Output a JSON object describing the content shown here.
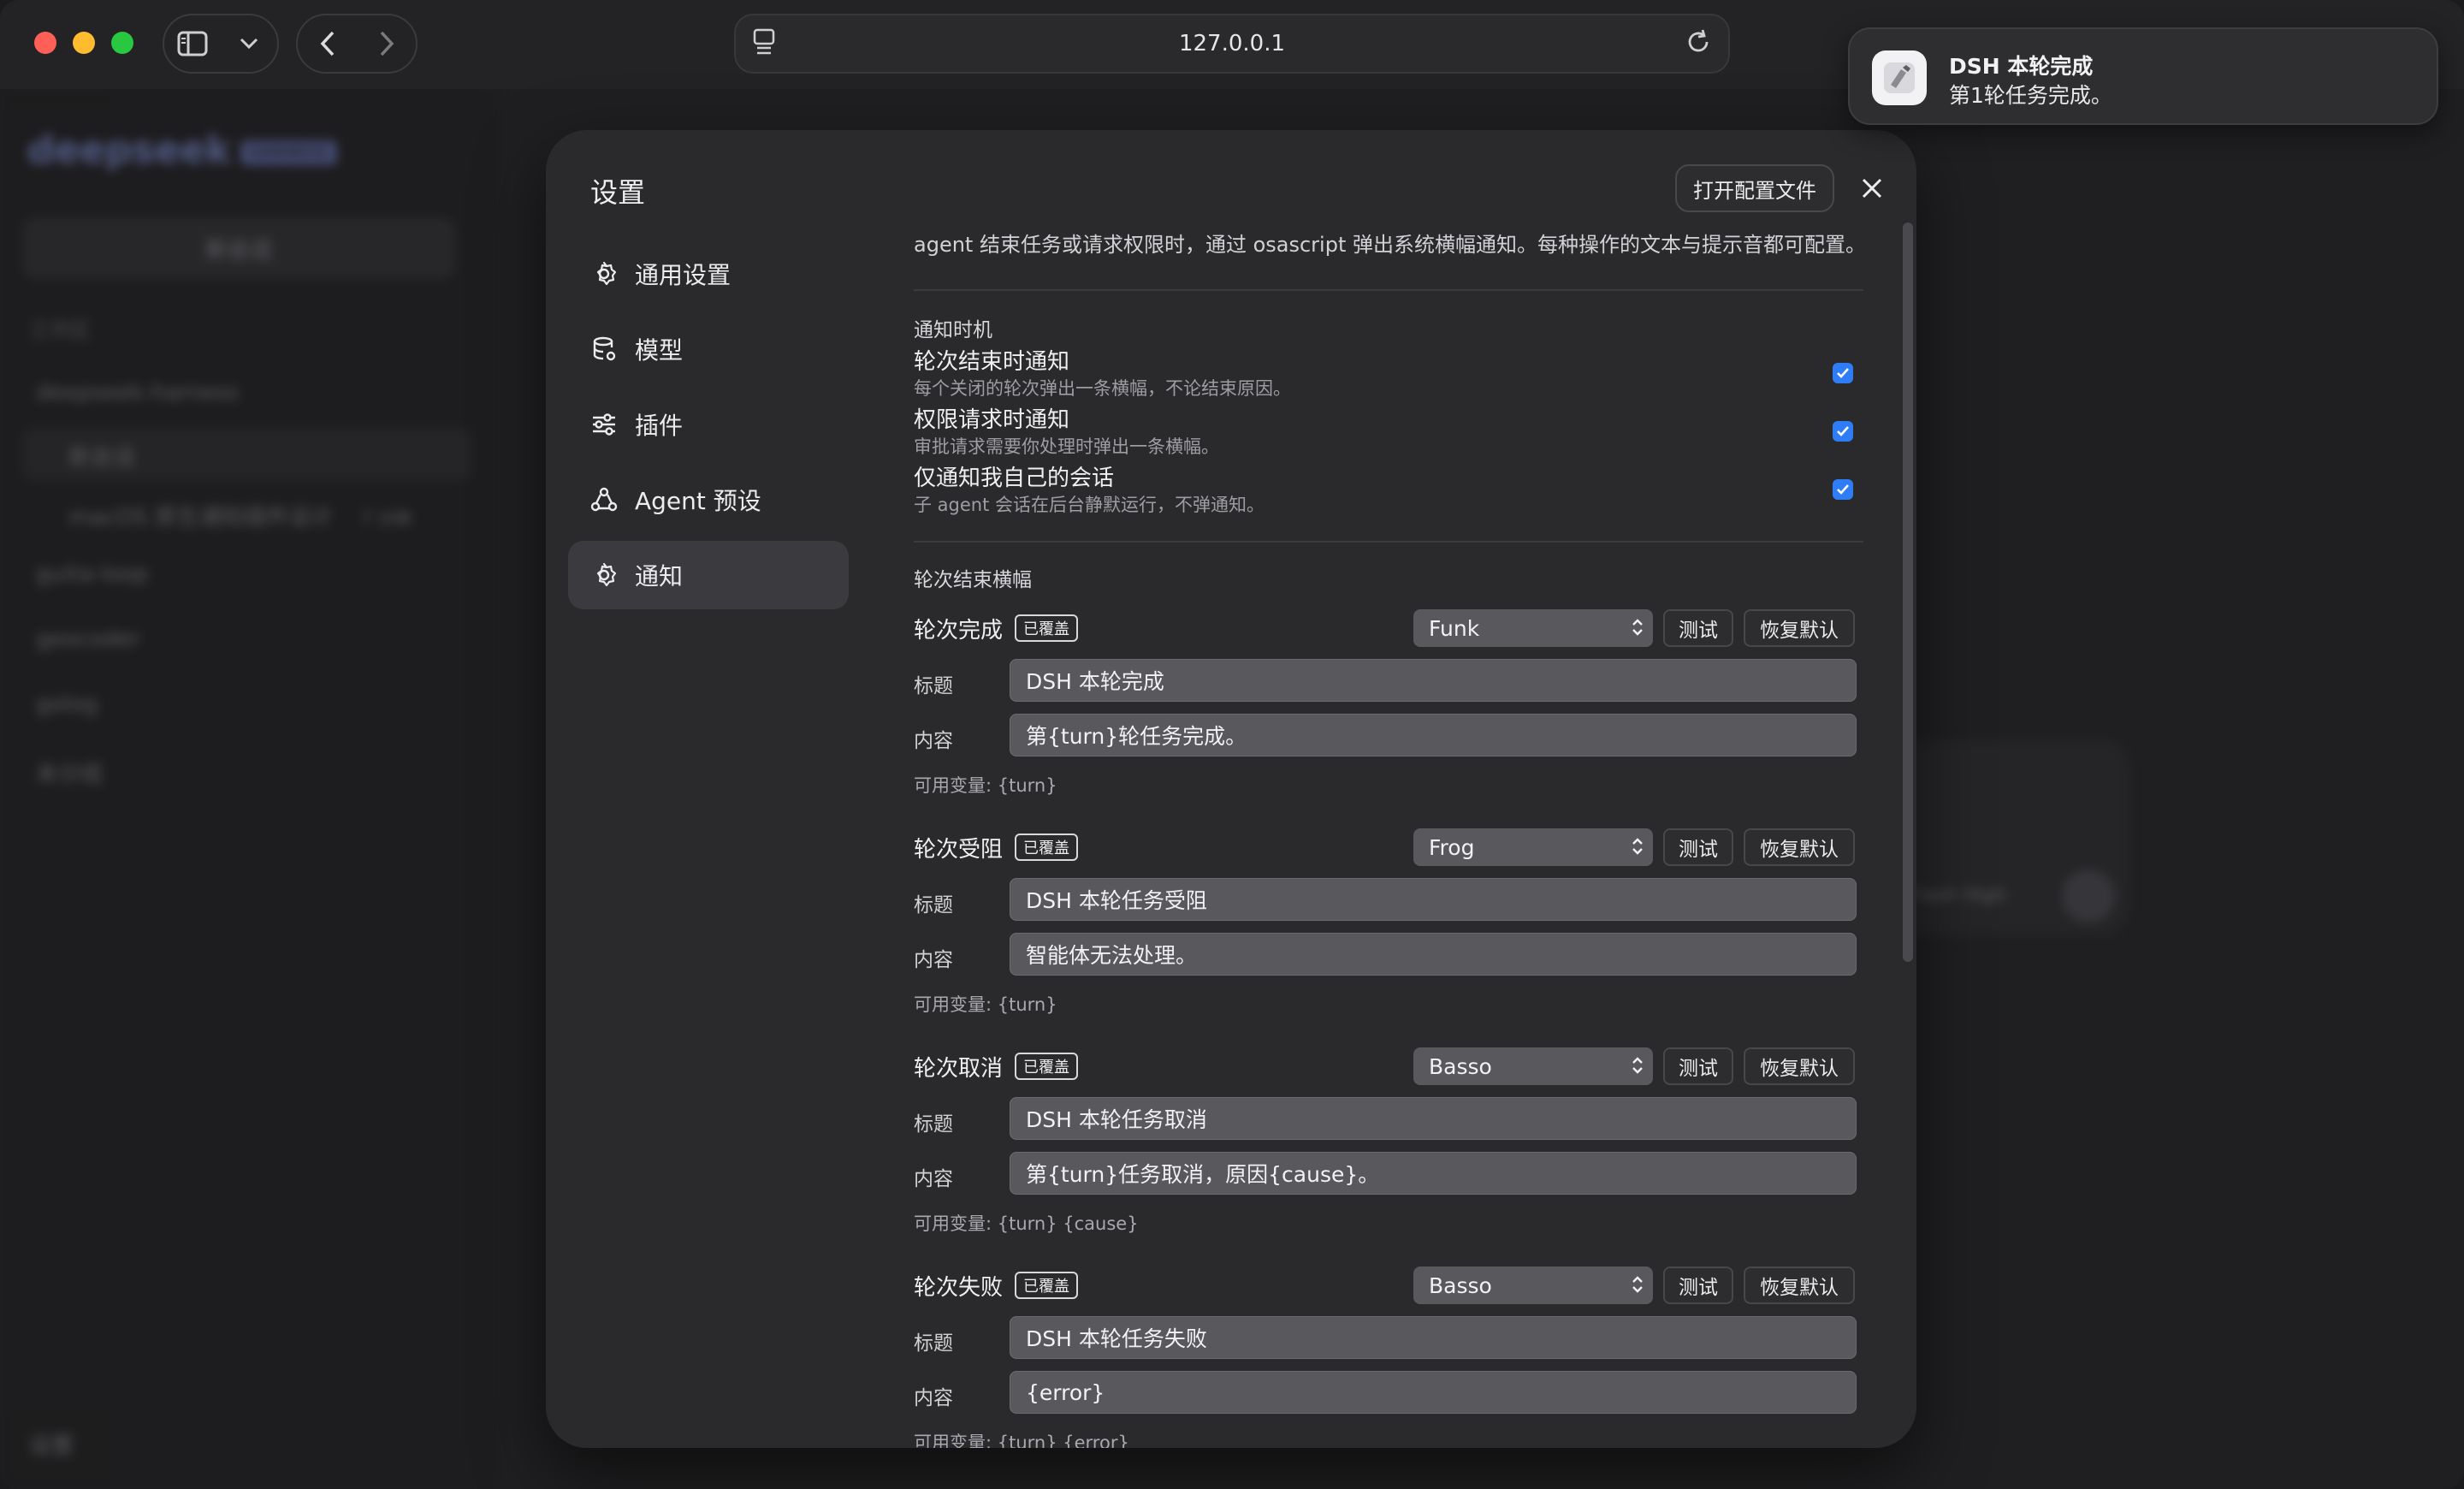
{
  "browser": {
    "url": "127.0.0.1"
  },
  "background_app": {
    "logo": "deepseek",
    "logo_badge": "HARNESS",
    "new_chat": "新会话",
    "workspace_label": "工作区",
    "items": [
      {
        "label": "deepseek-harness"
      },
      {
        "label": "新会话"
      },
      {
        "label": "macOS 原生通知插件设计",
        "time": "7 分钟"
      },
      {
        "label": "guita-loop"
      },
      {
        "label": "geocoder"
      },
      {
        "label": "golog"
      },
      {
        "label": "未分组"
      }
    ],
    "settings": "设置",
    "model_label": "Flash High"
  },
  "notification": {
    "title": "DSH 本轮完成",
    "body": "第1轮任务完成。"
  },
  "settings": {
    "title": "设置",
    "open_config": "打开配置文件",
    "nav": [
      {
        "label": "通用设置",
        "icon": "gear-icon"
      },
      {
        "label": "模型",
        "icon": "database-icon"
      },
      {
        "label": "插件",
        "icon": "sliders-icon"
      },
      {
        "label": "Agent 预设",
        "icon": "agent-icon"
      },
      {
        "label": "通知",
        "icon": "gear-icon"
      }
    ],
    "active_nav": "通知",
    "description": "agent 结束任务或请求权限时，通过 osascript 弹出系统横幅通知。每种操作的文本与提示音都可配置。",
    "timing": {
      "label": "通知时机",
      "options": [
        {
          "title": "轮次结束时通知",
          "subtitle": "每个关闭的轮次弹出一条横幅，不论结束原因。",
          "checked": true
        },
        {
          "title": "权限请求时通知",
          "subtitle": "审批请求需要你处理时弹出一条横幅。",
          "checked": true
        },
        {
          "title": "仅通知我自己的会话",
          "subtitle": "子 agent 会话在后台静默运行，不弹通知。",
          "checked": true
        }
      ]
    },
    "banner_section_label": "轮次结束横幅",
    "title_label": "标题",
    "body_label": "内容",
    "badge": "已覆盖",
    "test_label": "测试",
    "reset_label": "恢复默认",
    "groups": [
      {
        "name": "轮次完成",
        "sound": "Funk",
        "title": "DSH 本轮完成",
        "body": "第{turn}轮任务完成。",
        "vars": "可用变量: {turn}"
      },
      {
        "name": "轮次受阻",
        "sound": "Frog",
        "title": "DSH 本轮任务受阻",
        "body": "智能体无法处理。",
        "vars": "可用变量: {turn}"
      },
      {
        "name": "轮次取消",
        "sound": "Basso",
        "title": "DSH 本轮任务取消",
        "body": "第{turn}任务取消，原因{cause}。",
        "vars": "可用变量: {turn} {cause}"
      },
      {
        "name": "轮次失败",
        "sound": "Basso",
        "title": "DSH 本轮任务失败",
        "body": "{error}",
        "vars": "可用变量: {turn} {error}"
      }
    ]
  },
  "colors": {
    "accent_checkbox": "#2f7df6",
    "traffic_red": "#fe5f57",
    "traffic_yellow": "#febc2e",
    "traffic_green": "#28c840"
  }
}
